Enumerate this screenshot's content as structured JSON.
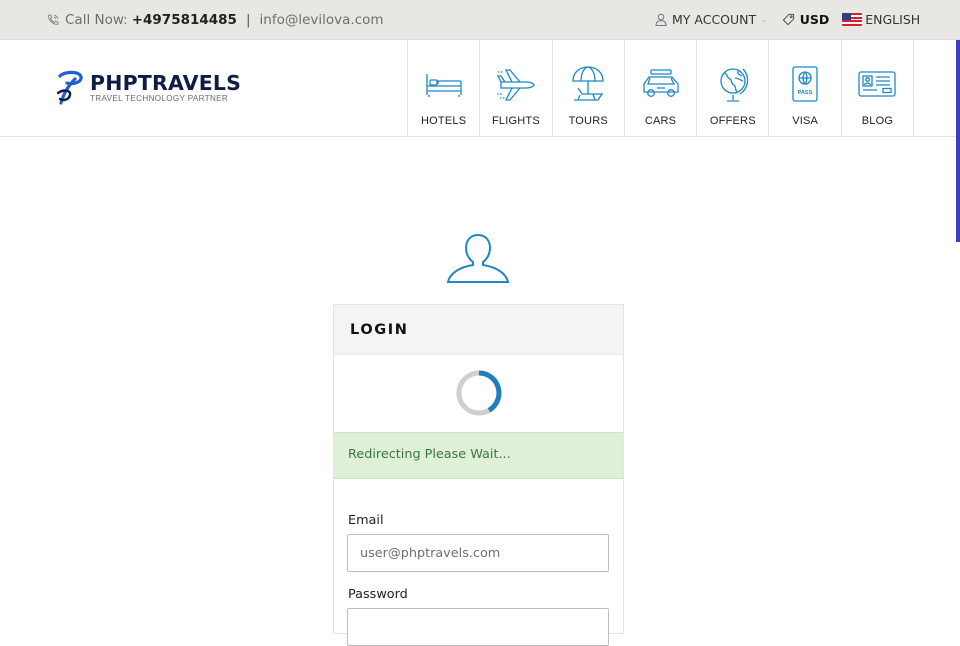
{
  "topbar": {
    "call_label": "Call Now:",
    "phone": "+4975814485",
    "separator": "|",
    "email": "info@levilova.com",
    "account_label": "MY ACCOUNT",
    "currency": "USD",
    "language": "ENGLISH"
  },
  "brand": {
    "name": "PHPTRAVELS",
    "tagline": "TRAVEL TECHNOLOGY PARTNER",
    "accent": "#1f5fd6",
    "dark": "#0f1c46"
  },
  "nav": {
    "items": [
      {
        "label": "HOTELS",
        "icon": "bed-icon"
      },
      {
        "label": "FLIGHTS",
        "icon": "airplane-icon"
      },
      {
        "label": "TOURS",
        "icon": "beach-umbrella-icon"
      },
      {
        "label": "CARS",
        "icon": "car-icon"
      },
      {
        "label": "OFFERS",
        "icon": "globe-icon"
      },
      {
        "label": "VISA",
        "icon": "passport-icon"
      },
      {
        "label": "BLOG",
        "icon": "id-card-icon"
      }
    ],
    "icon_color": "#1e88c7"
  },
  "login": {
    "title": "LOGIN",
    "status_message": "Redirecting Please Wait...",
    "email_label": "Email",
    "email_placeholder": "user@phptravels.com",
    "email_value": "",
    "password_label": "Password",
    "password_value": "",
    "success_bg": "#dff0d8",
    "success_text": "#3c763d"
  }
}
